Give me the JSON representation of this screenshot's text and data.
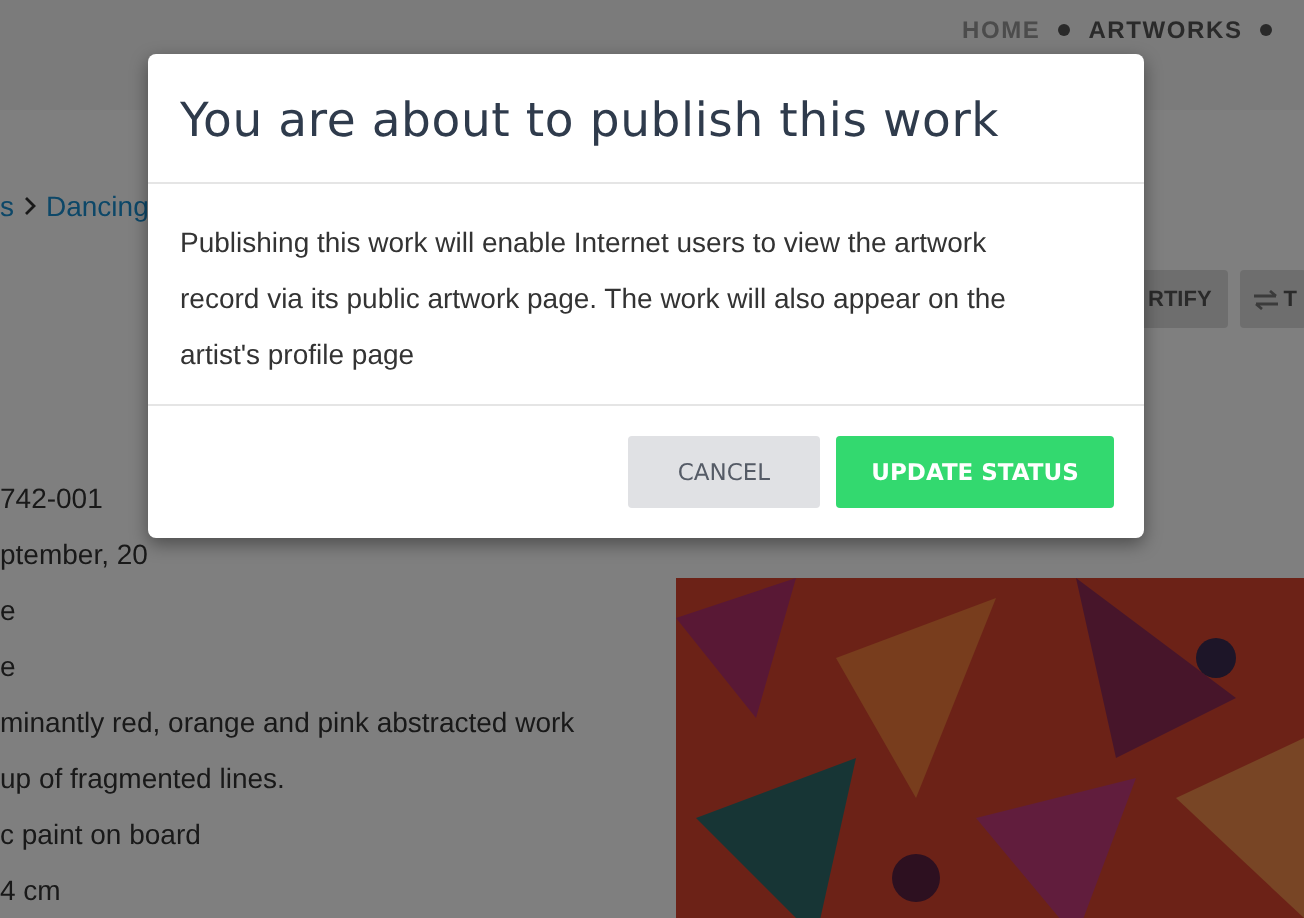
{
  "nav": {
    "items": [
      {
        "label": "HOME",
        "selected": false
      },
      {
        "label": "ARTWORKS",
        "selected": true
      }
    ]
  },
  "breadcrumb": [
    "s",
    "Dancing"
  ],
  "actions": [
    {
      "label": "RTIFY",
      "kind": "text"
    },
    {
      "label": "T",
      "kind": "transfer"
    }
  ],
  "details": [
    "742-001",
    "ptember, 20",
    "e",
    "e",
    "minantly red, orange and pink abstracted work",
    "up of fragmented lines.",
    "c paint on board",
    "4 cm"
  ],
  "dialog": {
    "title": "You are about to publish this work",
    "message": "Publishing this work will enable Internet users to view the artwork record via its public artwork page. The work will also appear on the artist's profile page",
    "buttons": [
      {
        "label": "CANCEL",
        "kind": "secondary"
      },
      {
        "label": "UPDATE STATUS",
        "kind": "primary"
      }
    ]
  }
}
